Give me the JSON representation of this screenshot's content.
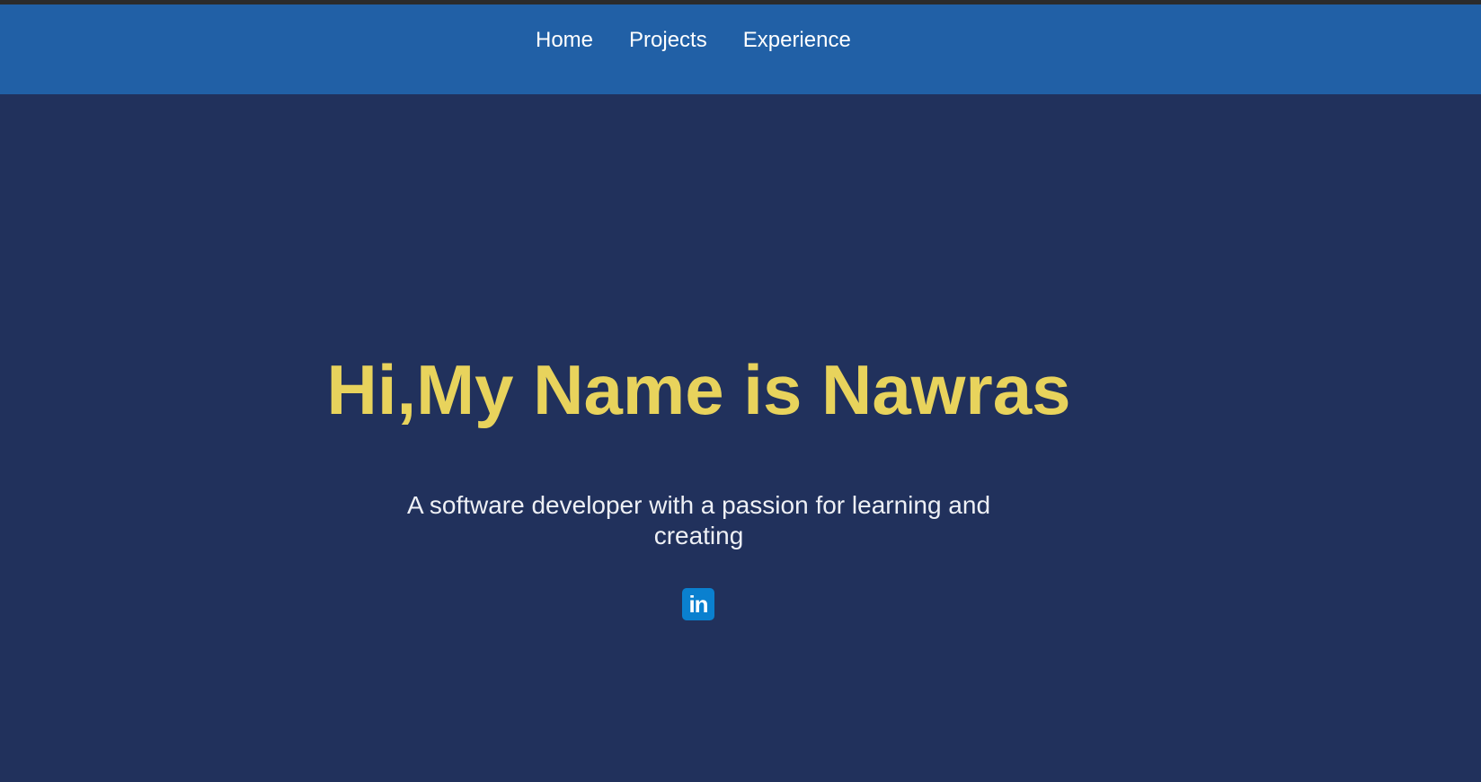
{
  "nav": {
    "items": [
      {
        "label": "Home"
      },
      {
        "label": "Projects"
      },
      {
        "label": "Experience"
      }
    ]
  },
  "hero": {
    "title": "Hi,My Name is Nawras",
    "subtitle": "A software developer with a passion for learning and creating",
    "social": {
      "linkedin_icon": "linkedin-icon",
      "linkedin_glyph": "in"
    }
  },
  "colors": {
    "background": "#21315c",
    "navbar": "#2160a6",
    "title": "#e8d35c",
    "linkedin": "#0a80cf"
  }
}
